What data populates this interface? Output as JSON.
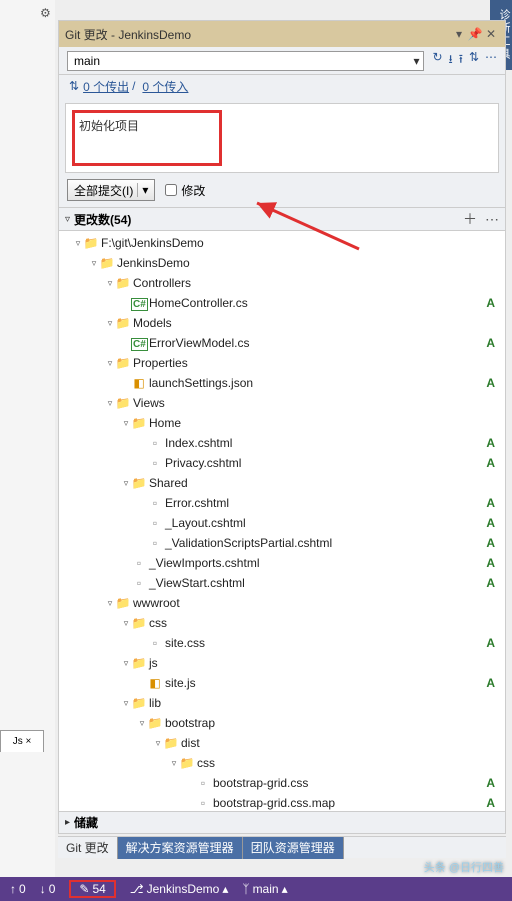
{
  "sideTool": "诊断工具",
  "panel": {
    "title": "Git 更改 - JenkinsDemo"
  },
  "branch": {
    "name": "main"
  },
  "sync": {
    "outgoing": "0 个传出",
    "incoming": "0 个传入"
  },
  "commit": {
    "message": "初始化项目",
    "button": "全部提交(I)",
    "modifyLabel": "修改"
  },
  "changes": {
    "header": "更改数(54)"
  },
  "stash": {
    "header": "储藏"
  },
  "tree": [
    {
      "d": 0,
      "exp": "▿",
      "ico": "folder",
      "txt": "F:\\git\\JenkinsDemo"
    },
    {
      "d": 1,
      "exp": "▿",
      "ico": "folder",
      "txt": "JenkinsDemo"
    },
    {
      "d": 2,
      "exp": "▿",
      "ico": "folder",
      "txt": "Controllers"
    },
    {
      "d": 3,
      "exp": "",
      "ico": "cs",
      "txt": "HomeController.cs",
      "badge": "A"
    },
    {
      "d": 2,
      "exp": "▿",
      "ico": "folder",
      "txt": "Models"
    },
    {
      "d": 3,
      "exp": "",
      "ico": "cs",
      "txt": "ErrorViewModel.cs",
      "badge": "A"
    },
    {
      "d": 2,
      "exp": "▿",
      "ico": "folder",
      "txt": "Properties"
    },
    {
      "d": 3,
      "exp": "",
      "ico": "js",
      "txt": "launchSettings.json",
      "badge": "A"
    },
    {
      "d": 2,
      "exp": "▿",
      "ico": "folder",
      "txt": "Views"
    },
    {
      "d": 3,
      "exp": "▿",
      "ico": "folder",
      "txt": "Home"
    },
    {
      "d": 4,
      "exp": "",
      "ico": "file",
      "txt": "Index.cshtml",
      "badge": "A"
    },
    {
      "d": 4,
      "exp": "",
      "ico": "file",
      "txt": "Privacy.cshtml",
      "badge": "A"
    },
    {
      "d": 3,
      "exp": "▿",
      "ico": "folder",
      "txt": "Shared"
    },
    {
      "d": 4,
      "exp": "",
      "ico": "file",
      "txt": "Error.cshtml",
      "badge": "A"
    },
    {
      "d": 4,
      "exp": "",
      "ico": "file",
      "txt": "_Layout.cshtml",
      "badge": "A"
    },
    {
      "d": 4,
      "exp": "",
      "ico": "file",
      "txt": "_ValidationScriptsPartial.cshtml",
      "badge": "A"
    },
    {
      "d": 3,
      "exp": "",
      "ico": "file",
      "txt": "_ViewImports.cshtml",
      "badge": "A"
    },
    {
      "d": 3,
      "exp": "",
      "ico": "file",
      "txt": "_ViewStart.cshtml",
      "badge": "A"
    },
    {
      "d": 2,
      "exp": "▿",
      "ico": "folder",
      "txt": "wwwroot"
    },
    {
      "d": 3,
      "exp": "▿",
      "ico": "folder",
      "txt": "css"
    },
    {
      "d": 4,
      "exp": "",
      "ico": "file",
      "txt": "site.css",
      "badge": "A"
    },
    {
      "d": 3,
      "exp": "▿",
      "ico": "folder",
      "txt": "js"
    },
    {
      "d": 4,
      "exp": "",
      "ico": "js",
      "txt": "site.js",
      "badge": "A"
    },
    {
      "d": 3,
      "exp": "▿",
      "ico": "folder",
      "txt": "lib"
    },
    {
      "d": 4,
      "exp": "▿",
      "ico": "folder",
      "txt": "bootstrap"
    },
    {
      "d": 5,
      "exp": "▿",
      "ico": "folder",
      "txt": "dist"
    },
    {
      "d": 6,
      "exp": "▿",
      "ico": "folder",
      "txt": "css"
    },
    {
      "d": 7,
      "exp": "",
      "ico": "file",
      "txt": "bootstrap-grid.css",
      "badge": "A"
    },
    {
      "d": 7,
      "exp": "",
      "ico": "file",
      "txt": "bootstrap-grid.css.map",
      "badge": "A"
    }
  ],
  "bottomTabs": {
    "t1": "Git 更改",
    "t2": "解决方案资源管理器",
    "t3": "团队资源管理器"
  },
  "status": {
    "up": "0",
    "down": "0",
    "pencil": "54",
    "repo": "JenkinsDemo",
    "branch": "main"
  },
  "watermark": "头条 @日行四善"
}
